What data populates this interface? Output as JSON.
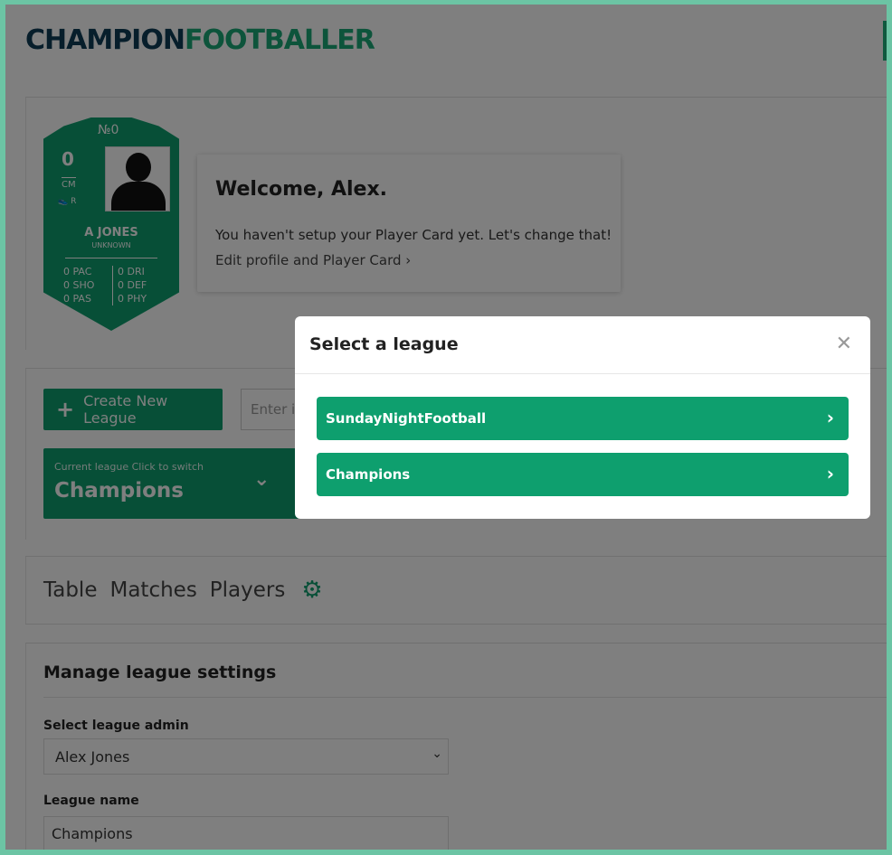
{
  "brand": {
    "part1": "CHAMPION",
    "part2": "FOOTBALLER"
  },
  "player_card": {
    "number": "№0",
    "rating": "0",
    "position": "CM",
    "foot": "R",
    "name": "A JONES",
    "club": "UNKNOWN",
    "stats_left": [
      "0 PAC",
      "0 SHO",
      "0 PAS"
    ],
    "stats_right": [
      "0 DRI",
      "0 DEF",
      "0 PHY"
    ]
  },
  "welcome": {
    "title": "Welcome, Alex.",
    "message": "You haven't setup your Player Card yet. Let's change that!",
    "edit_link": "Edit profile and Player Card"
  },
  "league_bar": {
    "create_label": "Create New League",
    "invite_placeholder": "Enter i",
    "current_hint": "Current league   Click to switch",
    "current_value": "Champions"
  },
  "tabs": [
    "Table",
    "Matches",
    "Players"
  ],
  "settings": {
    "title": "Manage league settings",
    "admin_label": "Select league admin",
    "admin_value": "Alex Jones",
    "name_label": "League name",
    "name_value": "Champions"
  },
  "modal": {
    "title": "Select a league",
    "leagues": [
      "SundayNightFootball",
      "Champions"
    ]
  },
  "colors": {
    "accent": "#0e9f6e",
    "brand_dark": "#0f3d57"
  }
}
